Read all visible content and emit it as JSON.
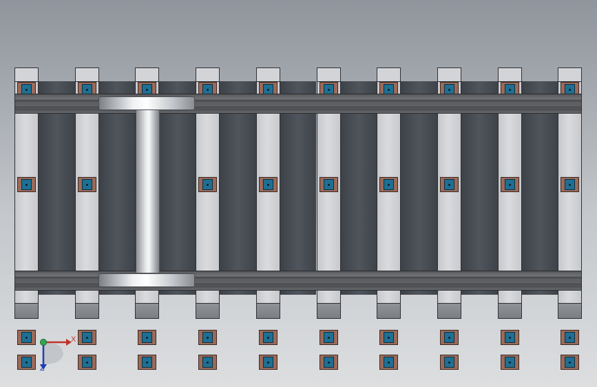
{
  "viewport": {
    "background": "#a3a8ae"
  },
  "track": {
    "sleeper_count": 10,
    "rail_color": "#606265",
    "pad_color": "#9b6a5a",
    "clip_color": "#1f6f93",
    "sleeper_color": "#d2d4d7"
  },
  "wheelset": {
    "color": "#e4e6e8"
  },
  "triad": {
    "x_label": "X",
    "z_label": "Z",
    "x_color": "#c0322a",
    "y_color": "#2fa84f",
    "z_color": "#1f3fb0"
  }
}
